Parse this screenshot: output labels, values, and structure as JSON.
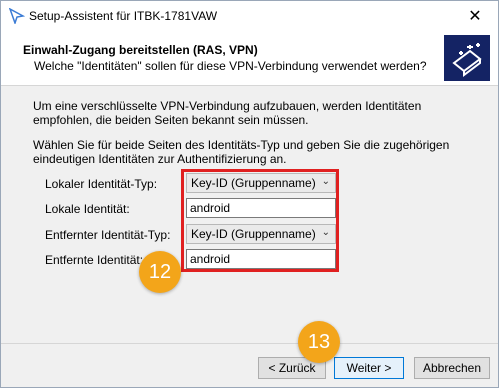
{
  "window": {
    "title": "Setup-Assistent für ITBK-1781VAW",
    "close_glyph": "✕"
  },
  "header": {
    "title": "Einwahl-Zugang bereitstellen (RAS, VPN)",
    "subtitle": "Welche \"Identitäten\" sollen für diese VPN-Verbindung verwendet werden?"
  },
  "intro": {
    "para1": "Um eine verschlüsselte VPN-Verbindung aufzubauen, werden Identitäten empfohlen, die beiden Seiten bekannt sein müssen.",
    "para2": "Wählen Sie für beide Seiten des Identitäts-Typ und geben Sie die zugehörigen eindeutigen Identitäten zur Authentifizierung an."
  },
  "form": {
    "local_type_label": "Lokaler Identität-Typ:",
    "local_type_value": "Key-ID (Gruppenname)",
    "local_id_label": "Lokale Identität:",
    "local_id_value": "android",
    "remote_type_label": "Entfernter Identität-Typ:",
    "remote_type_value": "Key-ID (Gruppenname)",
    "remote_id_label": "Entfernte Identität:",
    "remote_id_value": "android"
  },
  "badges": {
    "fields": "12",
    "next": "13"
  },
  "buttons": {
    "back": "< Zurück",
    "next": "Weiter >",
    "cancel": "Abbrechen"
  },
  "icons": {
    "app": "arrow-icon",
    "header": "network-device-icon",
    "dropdown": "chevron-down-icon"
  },
  "colors": {
    "highlight": "#e02020",
    "badge": "#f3a51a",
    "header_icon_bg": "#142364"
  }
}
